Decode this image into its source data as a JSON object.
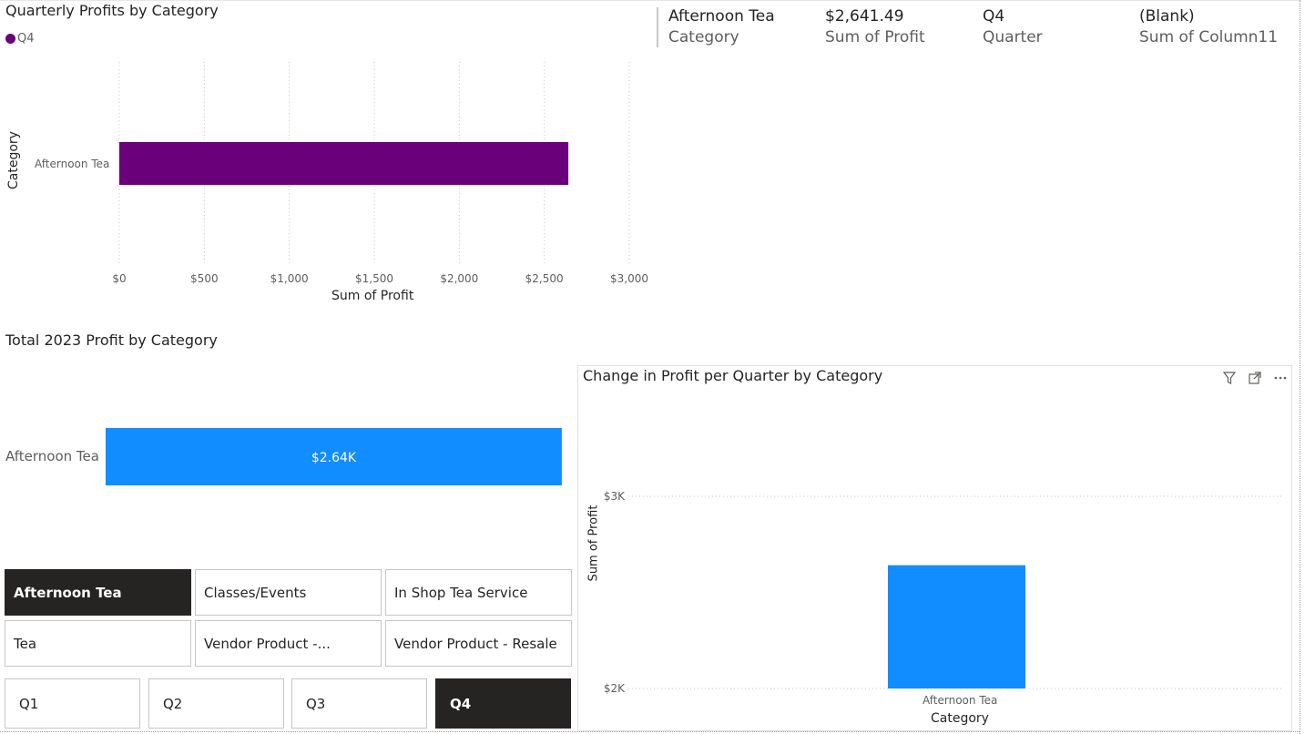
{
  "quarterly": {
    "title": "Quarterly Profits by Category",
    "legend": {
      "label": "Q4",
      "color": "#6B007B"
    },
    "y_axis_title": "Category",
    "x_axis_title": "Sum of Profit",
    "category_label": "Afternoon Tea",
    "ticks": [
      "$0",
      "$500",
      "$1,000",
      "$1,500",
      "$2,000",
      "$2,500",
      "$3,000"
    ]
  },
  "card": {
    "fields": [
      {
        "value": "Afternoon Tea",
        "label": "Category"
      },
      {
        "value": "$2,641.49",
        "label": "Sum of Profit"
      },
      {
        "value": "Q4",
        "label": "Quarter"
      },
      {
        "value": "(Blank)",
        "label": "Sum of Column11"
      }
    ]
  },
  "total": {
    "title": "Total 2023 Profit by Category",
    "category_label": "Afternoon Tea",
    "data_label": "$2.64K"
  },
  "change": {
    "title": "Change in Profit per Quarter by Category",
    "y_axis_title": "Sum of Profit",
    "x_axis_title": "Category",
    "ticks": [
      "$3K",
      "$2K"
    ],
    "category_label": "Afternoon Tea",
    "icons": [
      "filter-icon",
      "focus-mode-icon",
      "more-options-icon"
    ]
  },
  "category_slicer": {
    "items": [
      "Afternoon Tea",
      "Classes/Events",
      "In Shop Tea Service",
      "Tea",
      "Vendor Product -...",
      "Vendor Product - Resale"
    ],
    "selected": "Afternoon Tea"
  },
  "quarter_slicer": {
    "items": [
      "Q1",
      "Q2",
      "Q3",
      "Q4"
    ],
    "selected": "Q4"
  },
  "colors": {
    "q4_purple": "#6B007B",
    "total_blue": "#118DFF",
    "selected_tile": "#252423"
  },
  "chart_data": [
    {
      "type": "bar",
      "orientation": "horizontal",
      "title": "Quarterly Profits by Category",
      "categories": [
        "Afternoon Tea"
      ],
      "series": [
        {
          "name": "Q4",
          "values": [
            2641.49
          ]
        }
      ],
      "xlabel": "Sum of Profit",
      "ylabel": "Category",
      "xlim": [
        0,
        3000
      ],
      "legend": "top-left",
      "grid": true
    },
    {
      "type": "bar",
      "orientation": "horizontal",
      "title": "Total 2023 Profit by Category",
      "categories": [
        "Afternoon Tea"
      ],
      "values": [
        2641.49
      ],
      "data_labels": [
        "$2.64K"
      ],
      "xlim": [
        0,
        2700
      ],
      "grid": false
    },
    {
      "type": "bar",
      "orientation": "vertical",
      "title": "Change in Profit per Quarter by Category",
      "categories": [
        "Afternoon Tea"
      ],
      "values": [
        2641.49
      ],
      "xlabel": "Category",
      "ylabel": "Sum of Profit",
      "ylim": [
        2000,
        3000
      ],
      "grid": true
    }
  ]
}
